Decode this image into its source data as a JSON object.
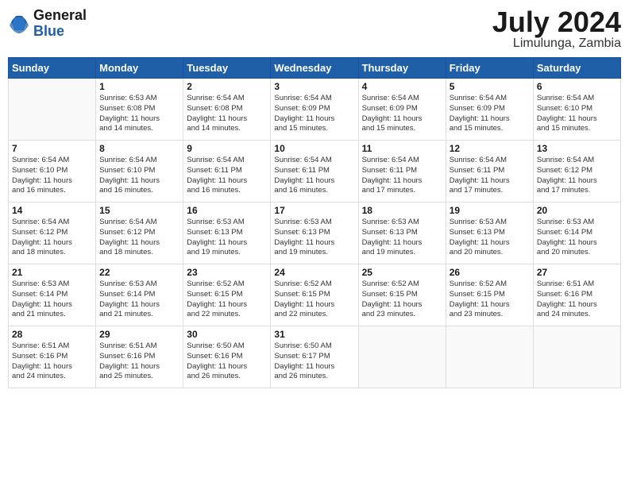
{
  "header": {
    "logo_general": "General",
    "logo_blue": "Blue",
    "month": "July 2024",
    "location": "Limulunga, Zambia"
  },
  "days_of_week": [
    "Sunday",
    "Monday",
    "Tuesday",
    "Wednesday",
    "Thursday",
    "Friday",
    "Saturday"
  ],
  "weeks": [
    [
      {
        "day": "",
        "info": ""
      },
      {
        "day": "1",
        "info": "Sunrise: 6:53 AM\nSunset: 6:08 PM\nDaylight: 11 hours\nand 14 minutes."
      },
      {
        "day": "2",
        "info": "Sunrise: 6:54 AM\nSunset: 6:08 PM\nDaylight: 11 hours\nand 14 minutes."
      },
      {
        "day": "3",
        "info": "Sunrise: 6:54 AM\nSunset: 6:09 PM\nDaylight: 11 hours\nand 15 minutes."
      },
      {
        "day": "4",
        "info": "Sunrise: 6:54 AM\nSunset: 6:09 PM\nDaylight: 11 hours\nand 15 minutes."
      },
      {
        "day": "5",
        "info": "Sunrise: 6:54 AM\nSunset: 6:09 PM\nDaylight: 11 hours\nand 15 minutes."
      },
      {
        "day": "6",
        "info": "Sunrise: 6:54 AM\nSunset: 6:10 PM\nDaylight: 11 hours\nand 15 minutes."
      }
    ],
    [
      {
        "day": "7",
        "info": "Sunrise: 6:54 AM\nSunset: 6:10 PM\nDaylight: 11 hours\nand 16 minutes."
      },
      {
        "day": "8",
        "info": "Sunrise: 6:54 AM\nSunset: 6:10 PM\nDaylight: 11 hours\nand 16 minutes."
      },
      {
        "day": "9",
        "info": "Sunrise: 6:54 AM\nSunset: 6:11 PM\nDaylight: 11 hours\nand 16 minutes."
      },
      {
        "day": "10",
        "info": "Sunrise: 6:54 AM\nSunset: 6:11 PM\nDaylight: 11 hours\nand 16 minutes."
      },
      {
        "day": "11",
        "info": "Sunrise: 6:54 AM\nSunset: 6:11 PM\nDaylight: 11 hours\nand 17 minutes."
      },
      {
        "day": "12",
        "info": "Sunrise: 6:54 AM\nSunset: 6:11 PM\nDaylight: 11 hours\nand 17 minutes."
      },
      {
        "day": "13",
        "info": "Sunrise: 6:54 AM\nSunset: 6:12 PM\nDaylight: 11 hours\nand 17 minutes."
      }
    ],
    [
      {
        "day": "14",
        "info": "Sunrise: 6:54 AM\nSunset: 6:12 PM\nDaylight: 11 hours\nand 18 minutes."
      },
      {
        "day": "15",
        "info": "Sunrise: 6:54 AM\nSunset: 6:12 PM\nDaylight: 11 hours\nand 18 minutes."
      },
      {
        "day": "16",
        "info": "Sunrise: 6:53 AM\nSunset: 6:13 PM\nDaylight: 11 hours\nand 19 minutes."
      },
      {
        "day": "17",
        "info": "Sunrise: 6:53 AM\nSunset: 6:13 PM\nDaylight: 11 hours\nand 19 minutes."
      },
      {
        "day": "18",
        "info": "Sunrise: 6:53 AM\nSunset: 6:13 PM\nDaylight: 11 hours\nand 19 minutes."
      },
      {
        "day": "19",
        "info": "Sunrise: 6:53 AM\nSunset: 6:13 PM\nDaylight: 11 hours\nand 20 minutes."
      },
      {
        "day": "20",
        "info": "Sunrise: 6:53 AM\nSunset: 6:14 PM\nDaylight: 11 hours\nand 20 minutes."
      }
    ],
    [
      {
        "day": "21",
        "info": "Sunrise: 6:53 AM\nSunset: 6:14 PM\nDaylight: 11 hours\nand 21 minutes."
      },
      {
        "day": "22",
        "info": "Sunrise: 6:53 AM\nSunset: 6:14 PM\nDaylight: 11 hours\nand 21 minutes."
      },
      {
        "day": "23",
        "info": "Sunrise: 6:52 AM\nSunset: 6:15 PM\nDaylight: 11 hours\nand 22 minutes."
      },
      {
        "day": "24",
        "info": "Sunrise: 6:52 AM\nSunset: 6:15 PM\nDaylight: 11 hours\nand 22 minutes."
      },
      {
        "day": "25",
        "info": "Sunrise: 6:52 AM\nSunset: 6:15 PM\nDaylight: 11 hours\nand 23 minutes."
      },
      {
        "day": "26",
        "info": "Sunrise: 6:52 AM\nSunset: 6:15 PM\nDaylight: 11 hours\nand 23 minutes."
      },
      {
        "day": "27",
        "info": "Sunrise: 6:51 AM\nSunset: 6:16 PM\nDaylight: 11 hours\nand 24 minutes."
      }
    ],
    [
      {
        "day": "28",
        "info": "Sunrise: 6:51 AM\nSunset: 6:16 PM\nDaylight: 11 hours\nand 24 minutes."
      },
      {
        "day": "29",
        "info": "Sunrise: 6:51 AM\nSunset: 6:16 PM\nDaylight: 11 hours\nand 25 minutes."
      },
      {
        "day": "30",
        "info": "Sunrise: 6:50 AM\nSunset: 6:16 PM\nDaylight: 11 hours\nand 26 minutes."
      },
      {
        "day": "31",
        "info": "Sunrise: 6:50 AM\nSunset: 6:17 PM\nDaylight: 11 hours\nand 26 minutes."
      },
      {
        "day": "",
        "info": ""
      },
      {
        "day": "",
        "info": ""
      },
      {
        "day": "",
        "info": ""
      }
    ]
  ]
}
